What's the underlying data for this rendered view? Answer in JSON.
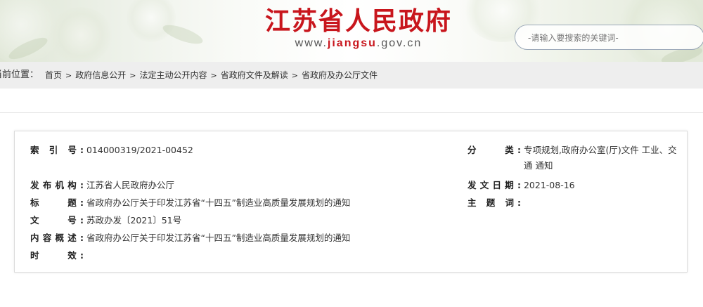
{
  "header": {
    "site_title": "江苏省人民政府",
    "url_prefix": "www.",
    "url_domain": "jiangsu",
    "url_suffix": ".gov.cn",
    "search_placeholder": "-请输入要搜索的关键词-",
    "brand_color": "#c8161d"
  },
  "breadcrumb": {
    "label": "当前位置：",
    "items": [
      "首页",
      "政府信息公开",
      "法定主动公开内容",
      "省政府文件及解读",
      "省政府及办公厅文件"
    ]
  },
  "info": {
    "index_label": "索 引 号:",
    "index_value": "014000319/2021-00452",
    "category_label": "分　　类:",
    "category_value": "专项规划,政府办公室(厅)文件 工业、交通 通知",
    "publisher_label": "发布机构:",
    "publisher_value": "江苏省人民政府办公厅",
    "date_label": "发文日期:",
    "date_value": "2021-08-16",
    "title_label": "标　　题:",
    "title_value": "省政府办公厅关于印发江苏省“十四五”制造业高质量发展规划的通知",
    "subject_label": "主 题 词:",
    "subject_value": "",
    "docno_label": "文　　号:",
    "docno_value": "苏政办发〔2021〕51号",
    "summary_label": "内容概述:",
    "summary_value": "省政府办公厅关于印发江苏省“十四五”制造业高质量发展规划的通知",
    "validity_label": "时　　效:",
    "validity_value": ""
  }
}
